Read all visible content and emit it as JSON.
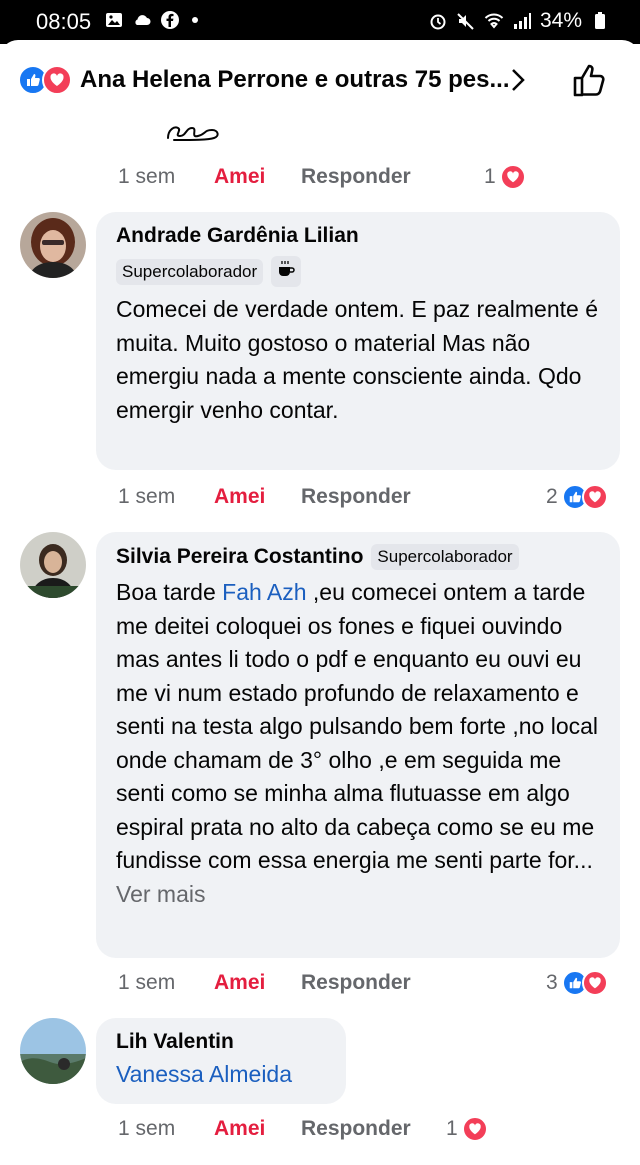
{
  "status": {
    "time": "08:05",
    "battery": "34%"
  },
  "reactions_bar": {
    "text": "Ana Helena Perrone e outras 75 pes..."
  },
  "comments": [
    {
      "actions": {
        "time": "1 sem",
        "amei": "Amei",
        "reply": "Responder"
      },
      "reaction_count": "1"
    },
    {
      "author": "Andrade Gardênia Lilian",
      "badge": "Supercolaborador",
      "text": "Comecei de verdade ontem. E paz realmente  é muita.  Muito gostoso o material Mas não emergiu nada a mente consciente  ainda. Qdo emergir venho contar.",
      "actions": {
        "time": "1 sem",
        "amei": "Amei",
        "reply": "Responder"
      },
      "reaction_count": "2"
    },
    {
      "author": "Silvia Pereira Costantino",
      "badge": "Supercolaborador",
      "text_before": "Boa tarde ",
      "mention": "Fah Azh",
      "text_after": " ,eu comecei ontem a tarde me deitei coloquei os fones e fiquei ouvindo mas antes li todo o pdf e enquanto eu ouvi eu me vi num estado profundo de relaxamento e senti na testa algo pulsando bem forte ,no local onde chamam de 3° olho ,e em seguida me senti como se minha alma flutuasse em algo espiral prata no alto da cabeça como se eu me fundisse com essa energia me senti parte for...",
      "see_more": "Ver mais",
      "actions": {
        "time": "1 sem",
        "amei": "Amei",
        "reply": "Responder"
      },
      "reaction_count": "3"
    },
    {
      "author": "Lih Valentin",
      "mention": "Vanessa Almeida",
      "actions": {
        "time": "1 sem",
        "amei": "Amei",
        "reply": "Responder"
      },
      "reaction_count": "1"
    }
  ],
  "colors": {
    "like_blue": "#1877f2",
    "love_red": "#f33e58",
    "amei_red": "#e41e3f",
    "bubble_bg": "#f0f2f5",
    "mention_blue": "#1b5fbf"
  }
}
